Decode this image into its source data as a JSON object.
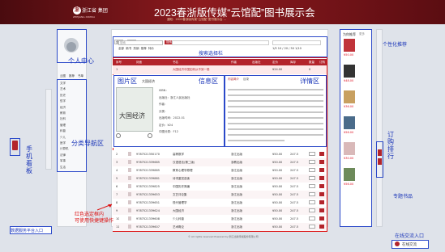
{
  "header": {
    "logo_text": "浙江省 集团",
    "logo_sub": "ZHEJIANG XINHUA",
    "title": "2023春浙版传媒“云馆配”图书展示会",
    "subtitle": "通知：2023春浙版传媒“云馆配”图书展示会 ..."
  },
  "left_sidebar": {
    "tabs": [
      "云图",
      "推荐",
      "书单"
    ],
    "categories": [
      "文学",
      "艺术",
      "历史",
      "哲学",
      "经济",
      "教育",
      "社科",
      "管理",
      "科普",
      "少儿",
      "医学",
      "计算机",
      "法律",
      "军事",
      "生活"
    ]
  },
  "toolbar": {
    "search_placeholder": "搜索",
    "search_button": "搜索",
    "filter_tabs": [
      "全部",
      "新书",
      "热销",
      "推荐",
      "特价"
    ],
    "pager": "1/5  10 / 20 / 50  1/10"
  },
  "table": {
    "headers": [
      "序号",
      "封面",
      "书名",
      "作者",
      "出版社",
      "定价",
      "库存",
      "数量",
      "订购"
    ],
    "first_row": {
      "no": "1",
      "title": "大国经济中国如何从不到一般",
      "price": "¥24.00",
      "qty": "0"
    },
    "rows": [
      {
        "isbn": "9787521350170",
        "title": "高等数学",
        "publisher": "浙江出版",
        "price": "¥50.00",
        "stock": "247.5"
      },
      {
        "isbn": "9787521339685",
        "title": "汉语语法(第二版)",
        "publisher": "浙教出版",
        "price": "¥50.00",
        "stock": "247.5"
      },
      {
        "isbn": "9787521339885",
        "title": "教育心理学原理",
        "publisher": "浙江出版",
        "price": "¥50.00",
        "stock": "247.5"
      },
      {
        "isbn": "9787521339881",
        "title": "诗词鉴赏选读",
        "publisher": "浙江出版",
        "price": "¥50.00",
        "stock": "247.5"
      },
      {
        "isbn": "9787521339825",
        "title": "中国历史简编",
        "publisher": "浙江出版",
        "price": "¥50.00",
        "stock": "247.5"
      },
      {
        "isbn": "9787521339653",
        "title": "文艺评论集",
        "publisher": "浙江出版",
        "price": "¥50.00",
        "stock": "247.5"
      },
      {
        "isbn": "9787521339651",
        "title": "现代管理学",
        "publisher": "浙江出版",
        "price": "¥50.00",
        "stock": "247.5"
      },
      {
        "isbn": "9787521339624",
        "title": "大国经济",
        "publisher": "浙江出版",
        "price": "¥50.00",
        "stock": "247.5"
      },
      {
        "isbn": "9787521339608",
        "title": "少儿科普",
        "publisher": "浙江出版",
        "price": "¥50.00",
        "stock": "247.5"
      },
      {
        "isbn": "9787521339607",
        "title": "艺术概论",
        "publisher": "浙江出版",
        "price": "¥50.00",
        "stock": "247.5"
      }
    ],
    "footer": "© All rights reserved Powered by 浙江出版传媒股份有限公司"
  },
  "info_panel": {
    "book_title": "大国经济",
    "fields": [
      "ISBN：",
      "出版社：浙江人民出版社",
      "作者：",
      "分类：",
      "出版时间：2022.01",
      "定价：¥24",
      "中图分类：F12"
    ]
  },
  "detail_panel": {
    "tabs": [
      "内容简介",
      "目录",
      "作者简介"
    ],
    "text_lines": 10
  },
  "right_panel": {
    "title": "为你推荐",
    "title_more": "更多",
    "prices": [
      "¥50.00",
      "¥48.00",
      "¥36.00",
      "¥56.00",
      "¥30.00",
      "¥56.00"
    ],
    "side_buttons": [
      "订购",
      "导出"
    ]
  },
  "bottom": {
    "left_btn": "数据服务平台入口",
    "right_btn": "在线交流"
  },
  "annotations": {
    "personal_center": "个人中心",
    "search_filter": "搜索选择栏",
    "picture_area": "图片区",
    "info_area": "信息区",
    "detail_area": "详情区",
    "category_nav": "分类导航区",
    "phone_view": "手机看板",
    "data_entry": "数据服务平台入口",
    "red_note_line1": "红色选定框内",
    "red_note_line2": "可使用快捷键操作",
    "personal_recommend": "个性化推荐",
    "order_ranking": "订购排行",
    "special_books": "专题书品",
    "online_chat_entry": "在线交流入口"
  },
  "colors": {
    "brand_red": "#b3242b",
    "annotation_blue": "#1a35b8",
    "annotation_red": "#dd1111"
  }
}
